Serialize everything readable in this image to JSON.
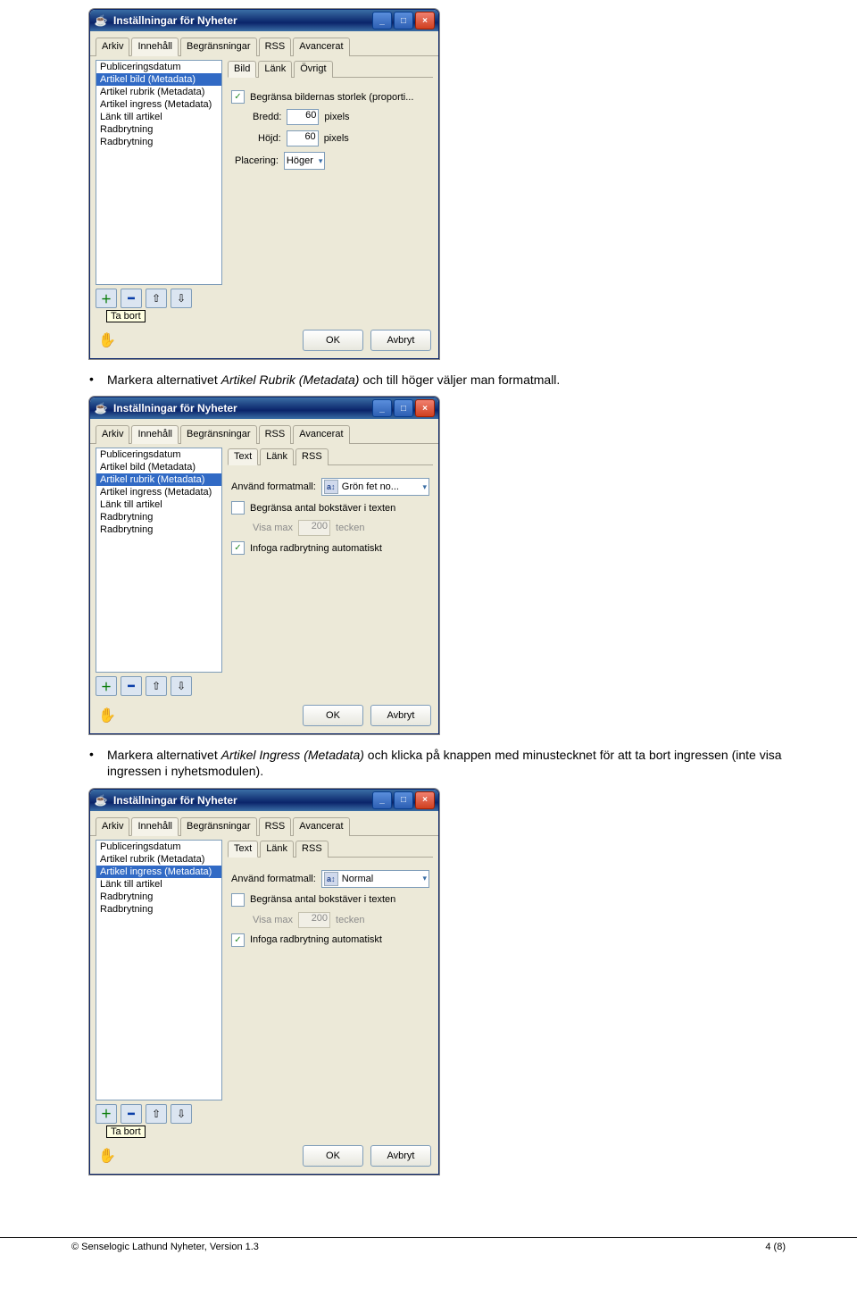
{
  "dialog_title": "Inställningar för Nyheter",
  "main_tabs": [
    "Arkiv",
    "Innehåll",
    "Begränsningar",
    "RSS",
    "Avancerat"
  ],
  "main_tab_active": 1,
  "panel1": {
    "list": [
      "Publiceringsdatum",
      "Artikel bild (Metadata)",
      "Artikel rubrik (Metadata)",
      "Artikel ingress (Metadata)",
      "Länk till artikel",
      "Radbrytning",
      "Radbrytning"
    ],
    "selected": 1,
    "subtabs": [
      "Bild",
      "Länk",
      "Övrigt"
    ],
    "subtab_active": 0,
    "limit_label": "Begränsa bildernas storlek (proporti...",
    "width_label": "Bredd:",
    "width_value": "60",
    "width_unit": "pixels",
    "height_label": "Höjd:",
    "height_value": "60",
    "height_unit": "pixels",
    "placement_label": "Placering:",
    "placement_value": "Höger",
    "tooltip": "Ta bort"
  },
  "bullets": {
    "b1_pre": "Markera alternativet ",
    "b1_it": "Artikel Rubrik (Metadata)",
    "b1_post": " och till höger väljer man formatmall.",
    "b2_pre": "Markera alternativet ",
    "b2_it": "Artikel Ingress (Metadata)",
    "b2_post": " och klicka på knappen med minustecknet för att ta bort ingressen (inte visa ingressen i nyhetsmodulen)."
  },
  "panel2": {
    "list": [
      "Publiceringsdatum",
      "Artikel bild (Metadata)",
      "Artikel rubrik (Metadata)",
      "Artikel ingress (Metadata)",
      "Länk till artikel",
      "Radbrytning",
      "Radbrytning"
    ],
    "selected": 2,
    "subtabs": [
      "Text",
      "Länk",
      "RSS"
    ],
    "subtab_active": 0,
    "format_label": "Använd formatmall:",
    "format_value": "Grön fet no...",
    "limit_chars_label": "Begränsa antal bokstäver i texten",
    "show_max_label": "Visa max",
    "show_max_value": "200",
    "show_max_unit": "tecken",
    "auto_break_label": "Infoga radbrytning automatiskt"
  },
  "panel3": {
    "list": [
      "Publiceringsdatum",
      "Artikel rubrik (Metadata)",
      "Artikel ingress (Metadata)",
      "Länk till artikel",
      "Radbrytning",
      "Radbrytning"
    ],
    "selected": 2,
    "subtabs": [
      "Text",
      "Länk",
      "RSS"
    ],
    "subtab_active": 0,
    "format_label": "Använd formatmall:",
    "format_value": "Normal",
    "limit_chars_label": "Begränsa antal bokstäver i texten",
    "show_max_label": "Visa max",
    "show_max_value": "200",
    "show_max_unit": "tecken",
    "auto_break_label": "Infoga radbrytning automatiskt",
    "tooltip": "Ta bort"
  },
  "buttons": {
    "ok": "OK",
    "cancel": "Avbryt"
  },
  "footer_left": "© Senselogic Lathund Nyheter, Version 1.3",
  "footer_right": "4 (8)"
}
